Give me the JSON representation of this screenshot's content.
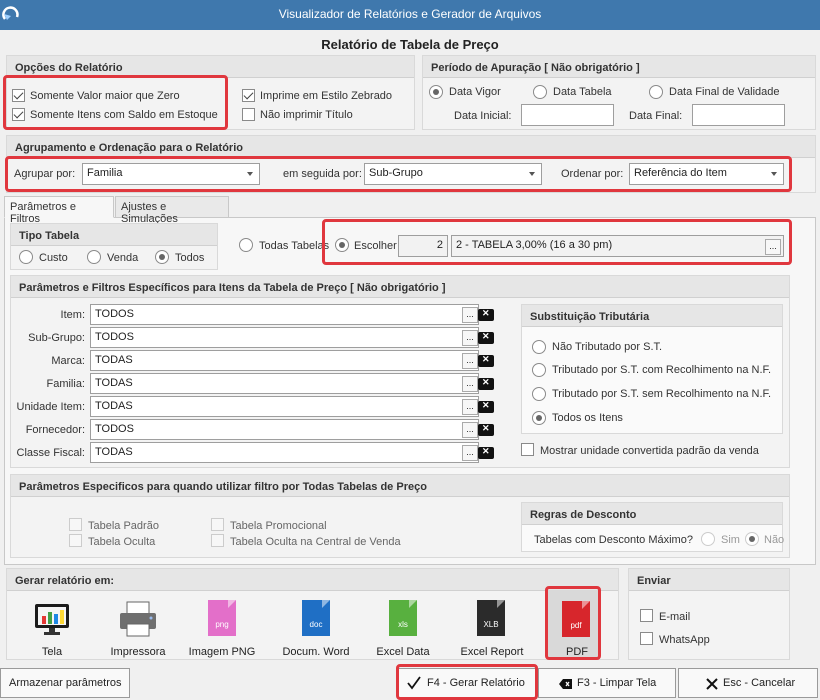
{
  "window": {
    "title": "Visualizador de Relatórios e Gerador de Arquivos"
  },
  "form": {
    "title": "Relatório de Tabela de Preço"
  },
  "opcoes": {
    "header": "Opções do Relatório",
    "somente_valor": "Somente Valor maior que Zero",
    "somente_itens": "Somente Itens com Saldo em Estoque",
    "imprime_zebrado": "Imprime em Estilo Zebrado",
    "nao_imprimir_titulo": "Não imprimir Título"
  },
  "periodo": {
    "header": "Período de Apuração [ Não obrigatório ]",
    "data_vigor": "Data Vigor",
    "data_tabela": "Data Tabela",
    "data_final_validade": "Data Final de Validade",
    "data_inicial": "Data Inicial:",
    "data_final": "Data Final:"
  },
  "agrupamento": {
    "header": "Agrupamento e Ordenação para o Relatório",
    "agrupar_label": "Agrupar por:",
    "agrupar_value": "Familia",
    "seguida_label": "em seguida por:",
    "seguida_value": "Sub-Grupo",
    "ordenar_label": "Ordenar por:",
    "ordenar_value": "Referência do Item"
  },
  "tabs": [
    "Parâmetros e Filtros",
    "Ajustes e Simulações"
  ],
  "tipo_tabela": {
    "header": "Tipo Tabela",
    "custo": "Custo",
    "venda": "Venda",
    "todos": "Todos",
    "todas_tabelas": "Todas Tabelas",
    "escolher": "Escolher",
    "tabela_num": "2",
    "tabela_desc": "2 - TABELA 3,00% (16 a 30 pm)",
    "ellipsis": "..."
  },
  "filtros": {
    "header": "Parâmetros e Filtros Específicos para Itens da Tabela de Preço [ Não obrigatório ]",
    "rows": [
      {
        "label": "Item:",
        "value": "TODOS"
      },
      {
        "label": "Sub-Grupo:",
        "value": "TODOS"
      },
      {
        "label": "Marca:",
        "value": "TODAS"
      },
      {
        "label": "Familia:",
        "value": "TODAS"
      },
      {
        "label": "Unidade Item:",
        "value": "TODAS"
      },
      {
        "label": "Fornecedor:",
        "value": "TODOS"
      },
      {
        "label": "Classe Fiscal:",
        "value": "TODAS"
      }
    ]
  },
  "substituicao": {
    "header": "Substituição Tributária",
    "nao_tributado": "Não Tributado por S.T.",
    "tributado_com": "Tributado por S.T. com Recolhimento na N.F.",
    "tributado_sem": "Tributado por S.T. sem Recolhimento na N.F.",
    "todos_itens": "Todos os Itens",
    "mostrar_unidade": "Mostrar unidade convertida padrão da venda"
  },
  "param_todas": {
    "header": "Parâmetros Especificos para quando utilizar filtro por Todas Tabelas de Preço",
    "padrao": "Tabela Padrão",
    "oculta": "Tabela Oculta",
    "promocional": "Tabela Promocional",
    "oculta_central": "Tabela Oculta na Central de Venda"
  },
  "regras": {
    "header": "Regras de Desconto",
    "tabelas_desconto": "Tabelas com Desconto Máximo?",
    "sim": "Sim",
    "nao": "Não"
  },
  "gerar": {
    "header": "Gerar relatório em:",
    "tela": "Tela",
    "impressora": "Impressora",
    "png": "Imagem PNG",
    "word": "Docum. Word",
    "excel": "Excel Data",
    "excel_report": "Excel Report",
    "pdf": "PDF",
    "png_icon": "png",
    "doc_icon": "doc",
    "xls_icon": "xls",
    "xlb_icon": "XLB",
    "pdf_icon": "pdf"
  },
  "enviar": {
    "header": "Enviar",
    "email": "E-mail",
    "whatsapp": "WhatsApp"
  },
  "footer": {
    "armazenar": "Armazenar parâmetros",
    "gerar": "F4 - Gerar Relatório",
    "limpar": "F3 - Limpar Tela",
    "cancelar": "Esc - Cancelar"
  },
  "colors": {
    "titlebar": "#3f78ad",
    "highlight": "#e0373e",
    "pdf": "#d7262c",
    "png": "#e36fc9",
    "doc": "#1f6fc5",
    "xls": "#58b03f",
    "xlb": "#2b2b2b"
  }
}
